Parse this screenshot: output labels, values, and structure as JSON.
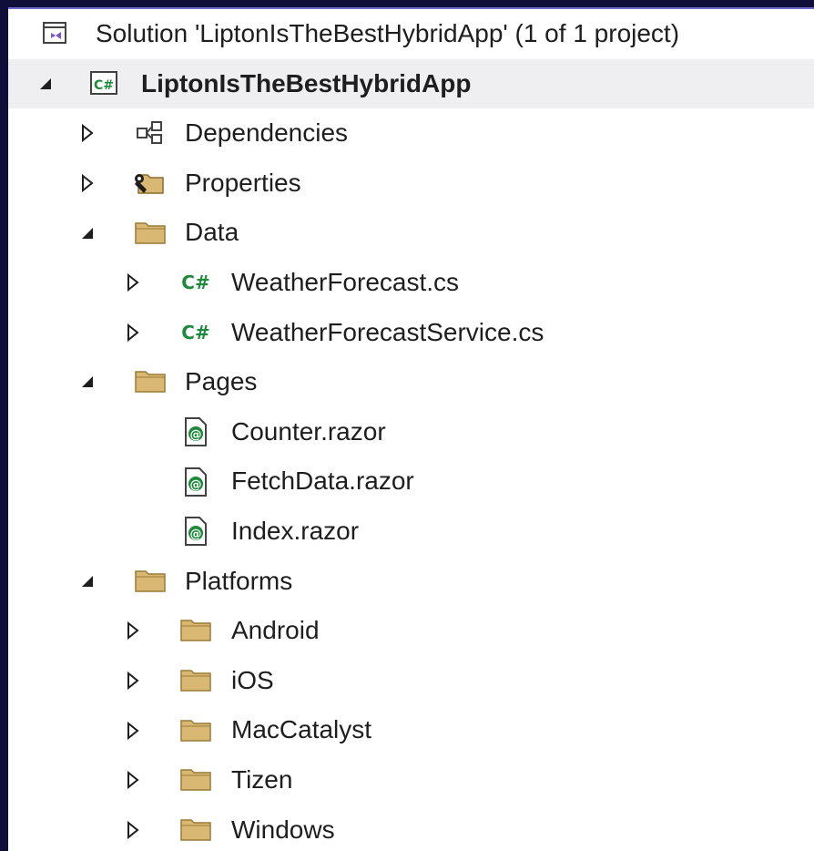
{
  "solution_explorer": {
    "items": [
      {
        "label": "Solution 'LiptonIsTheBestHybridApp' (1 of 1 project)",
        "icon": "solution-icon",
        "level": 0,
        "expand": "none"
      },
      {
        "label": "LiptonIsTheBestHybridApp",
        "icon": "csharp-project-icon",
        "level": 1,
        "expand": "expanded",
        "selected": true,
        "bold": true
      },
      {
        "label": "Dependencies",
        "icon": "dependencies-icon",
        "level": 2,
        "expand": "collapsed"
      },
      {
        "label": "Properties",
        "icon": "properties-folder-icon",
        "level": 2,
        "expand": "collapsed"
      },
      {
        "label": "Data",
        "icon": "folder-icon",
        "level": 2,
        "expand": "expanded"
      },
      {
        "label": "WeatherForecast.cs",
        "icon": "csharp-file-icon",
        "level": 3,
        "expand": "collapsed"
      },
      {
        "label": "WeatherForecastService.cs",
        "icon": "csharp-file-icon",
        "level": 3,
        "expand": "collapsed"
      },
      {
        "label": "Pages",
        "icon": "folder-icon",
        "level": 2,
        "expand": "expanded"
      },
      {
        "label": "Counter.razor",
        "icon": "razor-file-icon",
        "level": 3,
        "expand": "none"
      },
      {
        "label": "FetchData.razor",
        "icon": "razor-file-icon",
        "level": 3,
        "expand": "none"
      },
      {
        "label": "Index.razor",
        "icon": "razor-file-icon",
        "level": 3,
        "expand": "none"
      },
      {
        "label": "Platforms",
        "icon": "folder-icon",
        "level": 2,
        "expand": "expanded"
      },
      {
        "label": "Android",
        "icon": "folder-icon",
        "level": 3,
        "expand": "collapsed"
      },
      {
        "label": "iOS",
        "icon": "folder-icon",
        "level": 3,
        "expand": "collapsed"
      },
      {
        "label": "MacCatalyst",
        "icon": "folder-icon",
        "level": 3,
        "expand": "collapsed"
      },
      {
        "label": "Tizen",
        "icon": "folder-icon",
        "level": 3,
        "expand": "collapsed"
      },
      {
        "label": "Windows",
        "icon": "folder-icon",
        "level": 3,
        "expand": "collapsed"
      }
    ]
  },
  "colors": {
    "frame": "#0f0e3a",
    "accent": "#6f6bd0",
    "selected_row": "#efeff2",
    "folder": "#d8b873",
    "csharp": "#1b8a3a",
    "text": "#1e1e1e"
  }
}
